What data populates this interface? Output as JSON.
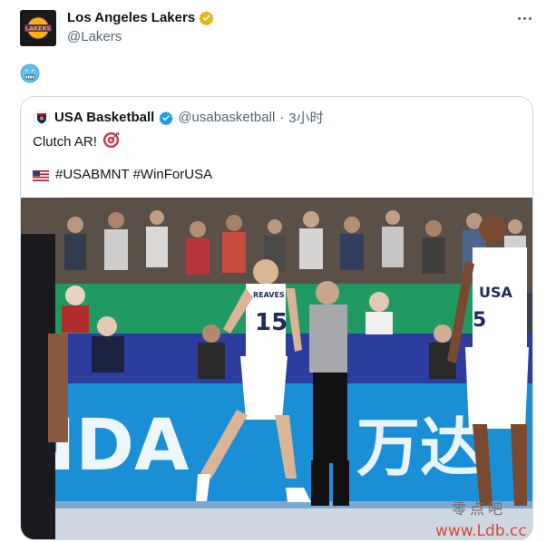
{
  "author": {
    "name": "Los Angeles Lakers",
    "handle": "@Lakers",
    "avatar_text": "LAKERS",
    "verified_icon": "gold-verified-badge-icon"
  },
  "more_icon": "more-options-icon",
  "tweet": {
    "emoji": "freezing-face-emoji"
  },
  "quoted": {
    "name": "USA Basketball",
    "handle": "@usabasketball",
    "separator": "·",
    "time": "3小时",
    "verified_icon": "blue-verified-badge-icon",
    "line1_text": "Clutch AR!",
    "line1_emoji": "direct-hit-target-emoji",
    "line2_flag": "us-flag-emoji",
    "line2_text": "#USABMNT #WinForUSA",
    "photo": {
      "description_icon": "game-photo",
      "left_player_number": "15",
      "left_player_name": "REAVES",
      "right_player_team": "USA",
      "right_player_number": "5",
      "court_ad_left": "NDA",
      "court_ad_right": "万达"
    }
  },
  "watermark": {
    "line1": "零点吧",
    "line2": "www.Ldb.cc"
  },
  "colors": {
    "brand_gold": "#f7b500",
    "verified_blue": "#1d9bf0",
    "court_blue": "#1a8fd6"
  }
}
